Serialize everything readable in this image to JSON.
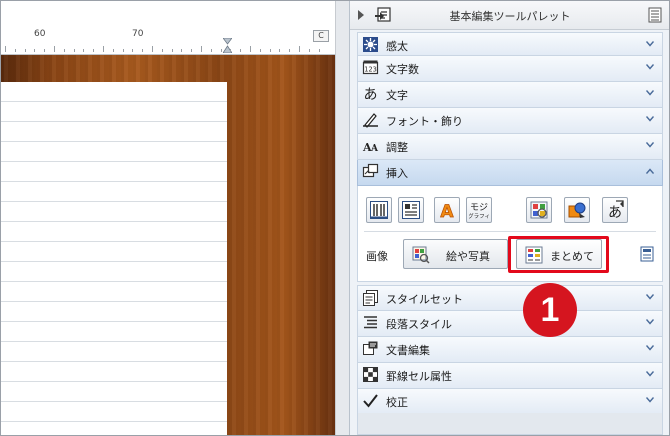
{
  "ruler": {
    "mark_60": "60",
    "mark_70": "70",
    "corner": "C"
  },
  "panel": {
    "title": "基本編集ツールパレット"
  },
  "sections_top": [
    {
      "label": "感太",
      "icon": "kanta-icon"
    },
    {
      "label": "文字数",
      "icon": "character-count-icon"
    },
    {
      "label": "文字",
      "icon": "hiragana-a-icon"
    },
    {
      "label": "フォント・飾り",
      "icon": "font-pen-icon"
    },
    {
      "label": "調整",
      "icon": "text-adjust-icon"
    },
    {
      "label": "挿入",
      "icon": "insert-icon"
    }
  ],
  "insert": {
    "image_label": "画像",
    "picture_button": "絵や写真",
    "combined_button": "まとめて",
    "tools": [
      "columns-tool-icon",
      "table-tool-icon",
      "wordart-tool-icon",
      "mojigraphy-tool-icon",
      "image-grid-tool-icon",
      "shape-tool-icon",
      "kana-tool-icon"
    ],
    "mojigraphy_text": "モジ",
    "mojigraphy_sub": "グラフィ"
  },
  "sections_bottom": [
    {
      "label": "スタイルセット",
      "icon": "style-set-icon"
    },
    {
      "label": "段落スタイル",
      "icon": "paragraph-style-icon"
    },
    {
      "label": "文書編集",
      "icon": "document-edit-icon"
    },
    {
      "label": "罫線セル属性",
      "icon": "ruled-cell-icon"
    },
    {
      "label": "校正",
      "icon": "proofread-check-icon"
    }
  ],
  "callout": {
    "number": "1"
  },
  "colors": {
    "highlight": "#e3091b",
    "badge": "#d5151f",
    "section_bg": "#e3ebf5",
    "active_bg": "#c6d9ef"
  }
}
